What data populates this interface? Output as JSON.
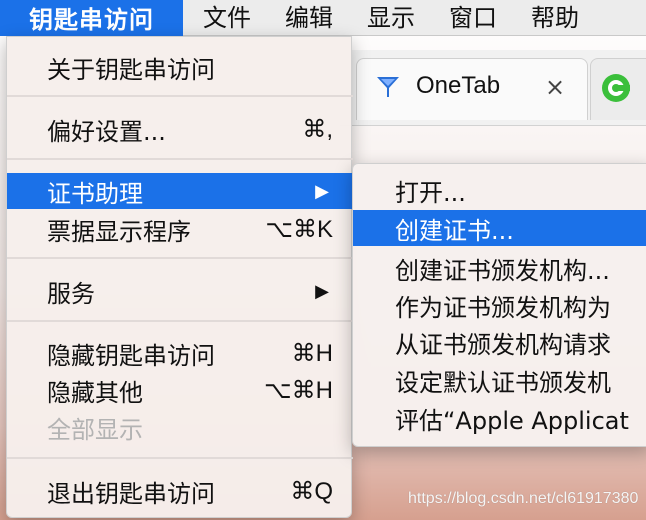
{
  "menubar": {
    "app": "钥匙串访问",
    "items": [
      "文件",
      "编辑",
      "显示",
      "窗口",
      "帮助"
    ]
  },
  "browser": {
    "tab_title": "OneTab",
    "tab_close": "×",
    "tab2_icon": "chrome-like-icon"
  },
  "menu": {
    "items": [
      {
        "label": "关于钥匙串访问",
        "shortcut": ""
      },
      {
        "label": "偏好设置...",
        "shortcut": "⌘,"
      },
      {
        "label": "证书助理",
        "shortcut": "",
        "submenu_arrow": "▶"
      },
      {
        "label": "票据显示程序",
        "shortcut": "⌥⌘K"
      },
      {
        "label": "服务",
        "shortcut": "",
        "submenu_arrow": "▶"
      },
      {
        "label": "隐藏钥匙串访问",
        "shortcut": "⌘H"
      },
      {
        "label": "隐藏其他",
        "shortcut": "⌥⌘H"
      },
      {
        "label": "全部显示",
        "shortcut": ""
      },
      {
        "label": "退出钥匙串访问",
        "shortcut": "⌘Q"
      }
    ]
  },
  "submenu": {
    "items": [
      {
        "label": "打开..."
      },
      {
        "label": "创建证书..."
      },
      {
        "label": "创建证书颁发机构..."
      },
      {
        "label": "作为证书颁发机构为"
      },
      {
        "label": "从证书颁发机构请求"
      },
      {
        "label": "设定默认证书颁发机"
      },
      {
        "label": "评估“Apple Applicat"
      }
    ]
  },
  "watermark": "https://blog.csdn.net/cl61917380",
  "colors": {
    "accent": "#1b71e8",
    "menubar": "#ececec"
  }
}
